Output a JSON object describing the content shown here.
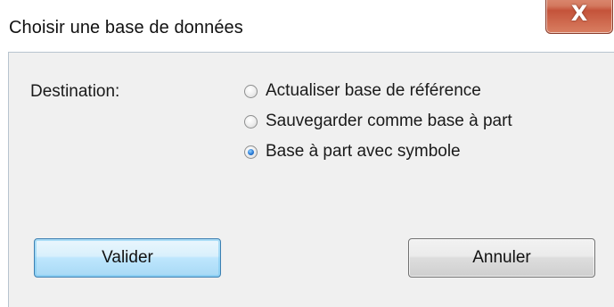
{
  "window": {
    "title": "Choisir une base de données",
    "close_glyph": "X"
  },
  "form": {
    "destination_label": "Destination:",
    "options": [
      {
        "label": "Actualiser base de référence",
        "checked": false
      },
      {
        "label": "Sauvegarder comme base à part",
        "checked": false
      },
      {
        "label": "Base à part avec symbole",
        "checked": true
      }
    ]
  },
  "buttons": {
    "ok_label": "Valider",
    "cancel_label": "Annuler"
  },
  "icons": {
    "close": "close-icon",
    "radio": "radio-icon"
  },
  "colors": {
    "close_button": "#c4533a",
    "focus_button_border": "#3c7fb1",
    "radio_checked": "#2a7ad6",
    "dialog_background": "#f0f0f0"
  }
}
